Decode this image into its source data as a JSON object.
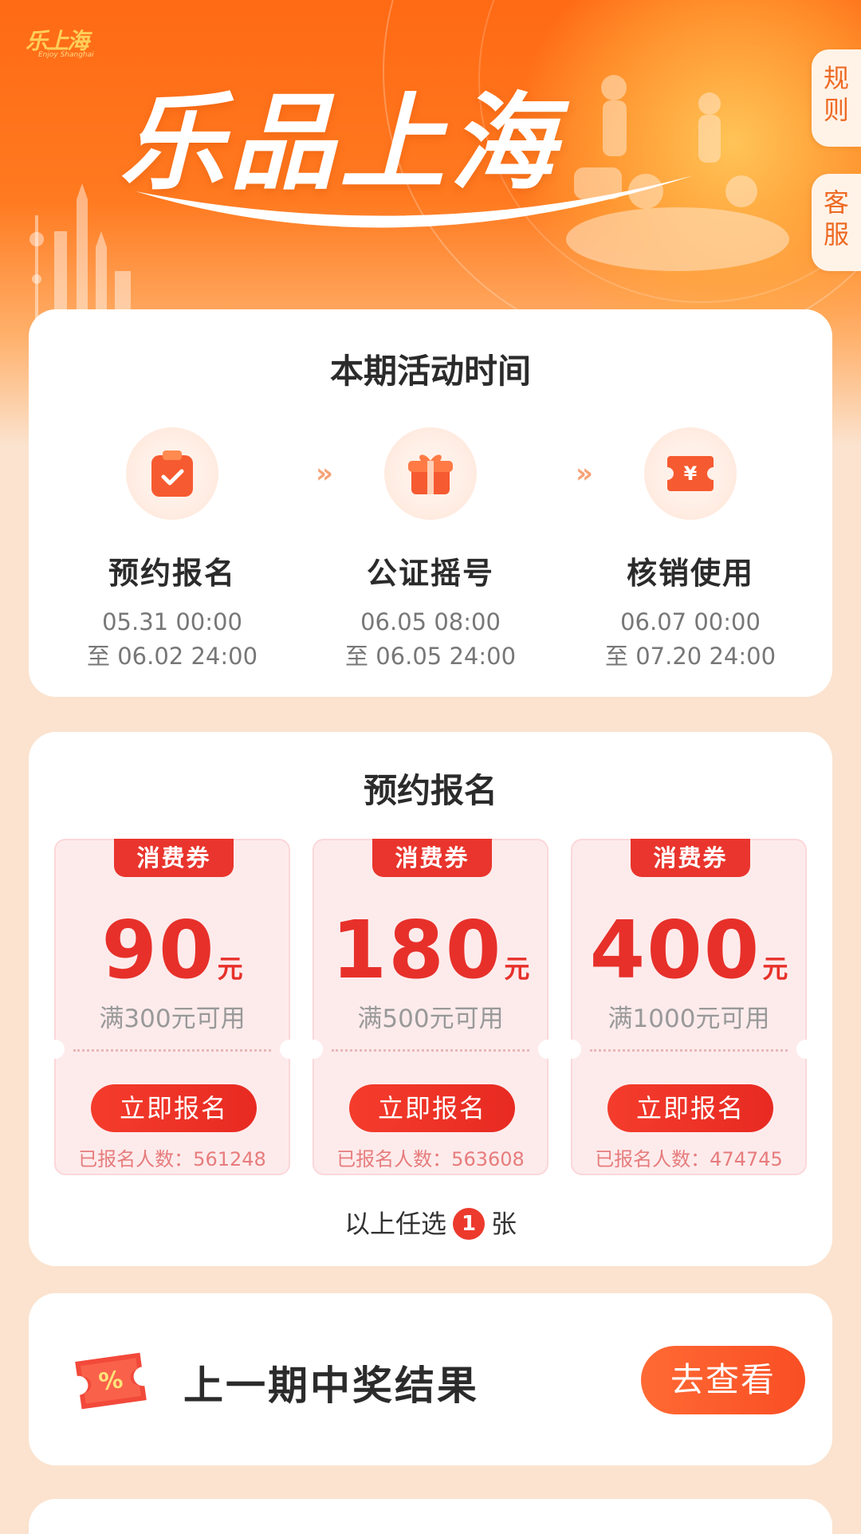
{
  "header": {
    "brand_small": "乐上海",
    "brand_sub": "Enjoy Shanghai",
    "hero_title": "乐品上海",
    "side_tabs": {
      "rules": "规则",
      "service": "客服"
    }
  },
  "schedule": {
    "title": "本期活动时间",
    "steps": [
      {
        "name": "预约报名",
        "start": "05.31 00:00",
        "end": "至 06.02 24:00"
      },
      {
        "name": "公证摇号",
        "start": "06.05 08:00",
        "end": "至 06.05 24:00"
      },
      {
        "name": "核销使用",
        "start": "06.07 00:00",
        "end": "至 07.20 24:00"
      }
    ],
    "arrow": "»"
  },
  "register": {
    "title": "预约报名",
    "coupons": [
      {
        "tag": "消费券",
        "amount": "90",
        "unit": "元",
        "condition": "满300元可用",
        "button": "立即报名",
        "count": "已报名人数：561248"
      },
      {
        "tag": "消费券",
        "amount": "180",
        "unit": "元",
        "condition": "满500元可用",
        "button": "立即报名",
        "count": "已报名人数：563608"
      },
      {
        "tag": "消费券",
        "amount": "400",
        "unit": "元",
        "condition": "满1000元可用",
        "button": "立即报名",
        "count": "已报名人数：474745"
      }
    ],
    "pick_prefix": "以上任选",
    "pick_count": "1",
    "pick_suffix": "张"
  },
  "results": {
    "title": "上一期中奖结果",
    "button": "去查看",
    "icon_text": "%"
  },
  "colors": {
    "primary": "#ff6a14",
    "coupon_red": "#e7302a",
    "page_bg": "#fbe3cf"
  }
}
